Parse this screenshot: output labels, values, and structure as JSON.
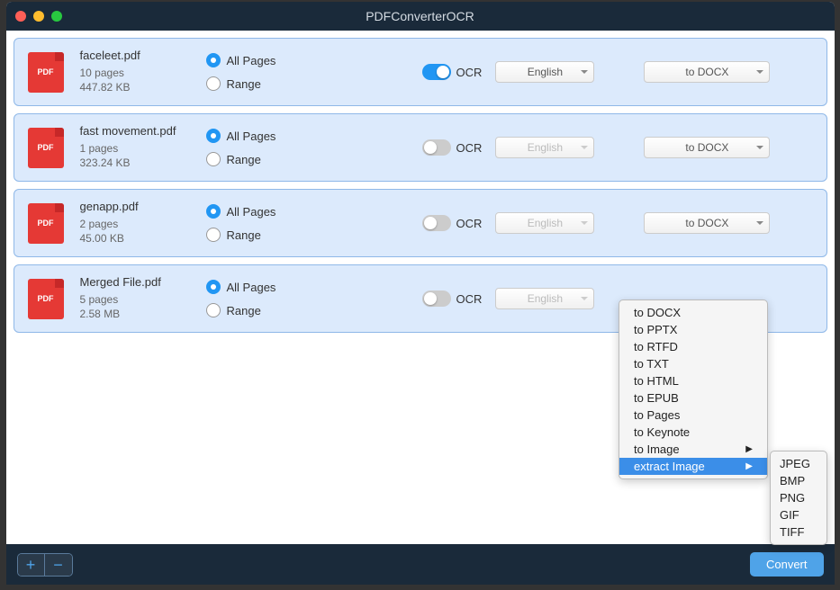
{
  "title": "PDFConverterOCR",
  "labels": {
    "allPages": "All Pages",
    "range": "Range",
    "ocr": "OCR",
    "language": "English",
    "add": "+",
    "remove": "−",
    "convert": "Convert"
  },
  "files": [
    {
      "name": "faceleet.pdf",
      "pages": "10 pages",
      "size": "447.82 KB",
      "ocrOn": true,
      "langEnabled": true,
      "format": "to DOCX",
      "showFormatDropdown": true
    },
    {
      "name": "fast movement.pdf",
      "pages": "1 pages",
      "size": "323.24 KB",
      "ocrOn": false,
      "langEnabled": false,
      "format": "to DOCX",
      "showFormatDropdown": true
    },
    {
      "name": "genapp.pdf",
      "pages": "2 pages",
      "size": "45.00 KB",
      "ocrOn": false,
      "langEnabled": false,
      "format": "to DOCX",
      "showFormatDropdown": true
    },
    {
      "name": "Merged File.pdf",
      "pages": "5 pages",
      "size": "2.58 MB",
      "ocrOn": false,
      "langEnabled": false,
      "format": "to DOCX",
      "showFormatDropdown": false
    }
  ],
  "menu": [
    {
      "label": "to DOCX",
      "hasSub": false,
      "highlighted": false
    },
    {
      "label": "to PPTX",
      "hasSub": false,
      "highlighted": false
    },
    {
      "label": "to RTFD",
      "hasSub": false,
      "highlighted": false
    },
    {
      "label": "to TXT",
      "hasSub": false,
      "highlighted": false
    },
    {
      "label": "to HTML",
      "hasSub": false,
      "highlighted": false
    },
    {
      "label": "to EPUB",
      "hasSub": false,
      "highlighted": false
    },
    {
      "label": "to Pages",
      "hasSub": false,
      "highlighted": false
    },
    {
      "label": "to Keynote",
      "hasSub": false,
      "highlighted": false
    },
    {
      "label": "to Image",
      "hasSub": true,
      "highlighted": false
    },
    {
      "label": "extract Image",
      "hasSub": true,
      "highlighted": true
    }
  ],
  "submenu": [
    "JPEG",
    "BMP",
    "PNG",
    "GIF",
    "TIFF"
  ]
}
